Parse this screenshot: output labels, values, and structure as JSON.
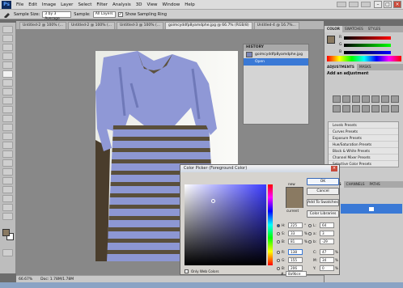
{
  "menubar": {
    "logo": "Ps",
    "items": [
      "File",
      "Edit",
      "Image",
      "Layer",
      "Select",
      "Filter",
      "Analysis",
      "3D",
      "View",
      "Window",
      "Help"
    ]
  },
  "options": {
    "sample_size_label": "Sample Size:",
    "sample_size_value": "3 by 3 Average",
    "sample_label": "Sample:",
    "sample_value": "All Layers",
    "show_ring_label": "Show Sampling Ring",
    "show_ring_checked": true
  },
  "tabs": [
    {
      "label": "Untitled-2 @ 100% (...",
      "active": false
    },
    {
      "label": "Untitled-2 @ 100% (...",
      "active": false
    },
    {
      "label": "Untitled-3 @ 100% (...",
      "active": false
    },
    {
      "label": "goimcyddfp8yamdphe.jpg @ 66.7% (RGB/8)",
      "active": true
    },
    {
      "label": "Untitled-4 @ 16.7%...",
      "active": false
    }
  ],
  "status": {
    "zoom": "66.67%",
    "doc": "Doc: 1.78M/1.78M"
  },
  "history": {
    "title": "HISTORY",
    "items": [
      {
        "label": "goimcyddfp8yamdphe.jpg",
        "selected": false
      },
      {
        "label": "Open",
        "selected": true
      }
    ]
  },
  "panels": {
    "color_tabs": [
      "COLOR",
      "SWATCHES",
      "STYLES"
    ],
    "slider_labels": [
      "R",
      "G",
      "B"
    ],
    "adjust_tabs": [
      "ADJUSTMENTS",
      "MASKS"
    ],
    "adjust_title": "Add an adjustment",
    "presets": [
      "Levels Presets",
      "Curves Presets",
      "Exposure Presets",
      "Hue/Saturation Presets",
      "Black & White Presets",
      "Channel Mixer Presets",
      "Selective Color Presets"
    ],
    "lower_tabs": [
      "LAYERS",
      "CHANNELS",
      "PATHS"
    ]
  },
  "picker": {
    "title": "Color Picker (Foreground Color)",
    "new_label": "new",
    "current_label": "current",
    "ok": "OK",
    "cancel": "Cancel",
    "add_swatches": "Add To Swatches",
    "libraries": "Color Libraries",
    "only_web": "Only Web Colors",
    "H": "225",
    "H_unit": "°",
    "S": "33",
    "S_unit": "%",
    "Bv": "81",
    "B_unit": "%",
    "R": "138",
    "G": "155",
    "Bl": "206",
    "L": "64",
    "a": "3",
    "b": "-29",
    "C": "47",
    "M": "34",
    "Y": "0",
    "K": "0",
    "pct": "%",
    "hex_label": "#",
    "hex": "8a9bce",
    "new_color": "#8a9bce",
    "current_color": "#8a9bce"
  },
  "colors": {
    "dress_blue": "#8d97d3",
    "lace_dark": "#5a4f3b",
    "selection": "#3a79d6"
  }
}
